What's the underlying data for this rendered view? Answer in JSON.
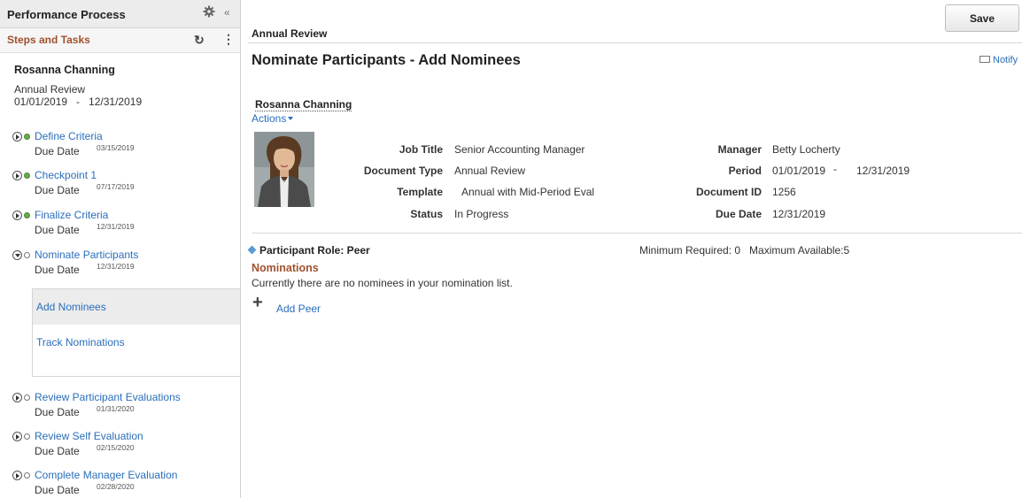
{
  "sidebar": {
    "title": "Performance Process",
    "collapse_glyph": "«",
    "steps_title": "Steps and Tasks",
    "employee_name": "Rosanna Channing",
    "document_name": "Annual Review",
    "document_dates": "01/01/2019   -   12/31/2019",
    "due_label": "Due Date",
    "steps": [
      {
        "label": "Define Criteria",
        "date": "03/15/2019",
        "status": "complete"
      },
      {
        "label": "Checkpoint 1",
        "date": "07/17/2019",
        "status": "complete"
      },
      {
        "label": "Finalize Criteria",
        "date": "12/31/2019",
        "status": "complete"
      },
      {
        "label": "Nominate Participants",
        "date": "12/31/2019",
        "status": "in-progress",
        "expanded": true
      },
      {
        "label": "Review Participant Evaluations",
        "date": "01/31/2020",
        "status": "not-started"
      },
      {
        "label": "Review Self Evaluation",
        "date": "02/15/2020",
        "status": "not-started"
      },
      {
        "label": "Complete Manager Evaluation",
        "date": "02/28/2020",
        "status": "not-started"
      }
    ],
    "subtasks": [
      {
        "label": "Add Nominees",
        "active": true
      },
      {
        "label": "Track Nominations",
        "active": false
      }
    ]
  },
  "toolbar": {
    "save_label": "Save"
  },
  "header": {
    "section_title": "Annual Review",
    "page_title": "Nominate Participants - Add Nominees",
    "notify_label": "Notify"
  },
  "employee": {
    "name": "Rosanna Channing",
    "actions_label": "Actions",
    "fields": {
      "job_title_label": "Job Title",
      "job_title": "Senior Accounting Manager",
      "document_type_label": "Document Type",
      "document_type": "Annual Review",
      "template_label": "Template",
      "template": "Annual with Mid-Period Eval",
      "status_label": "Status",
      "status": "In Progress",
      "manager_label": "Manager",
      "manager": "Betty Locherty",
      "period_label": "Period",
      "period_start": "01/01/2019",
      "period_sep": "-",
      "period_end": "12/31/2019",
      "document_id_label": "Document ID",
      "document_id": "1256",
      "due_date_label": "Due Date",
      "due_date": "12/31/2019"
    }
  },
  "participants": {
    "role_label": "Participant Role: Peer",
    "min_max": "Minimum Required: 0   Maximum Available:5",
    "nominations_title": "Nominations",
    "empty_message": "Currently there are no nominees in your nomination list.",
    "add_label": "Add Peer"
  },
  "colors": {
    "link": "#2a6ebb",
    "section_heading": "#a0522d",
    "complete_dot": "#6aa84f"
  },
  "icons": [
    "gear-icon",
    "collapse-icon",
    "refresh-icon",
    "more-icon",
    "play-icon",
    "status-dot-icon",
    "notify-icon",
    "caret-down-icon",
    "diamond-icon",
    "plus-icon"
  ]
}
